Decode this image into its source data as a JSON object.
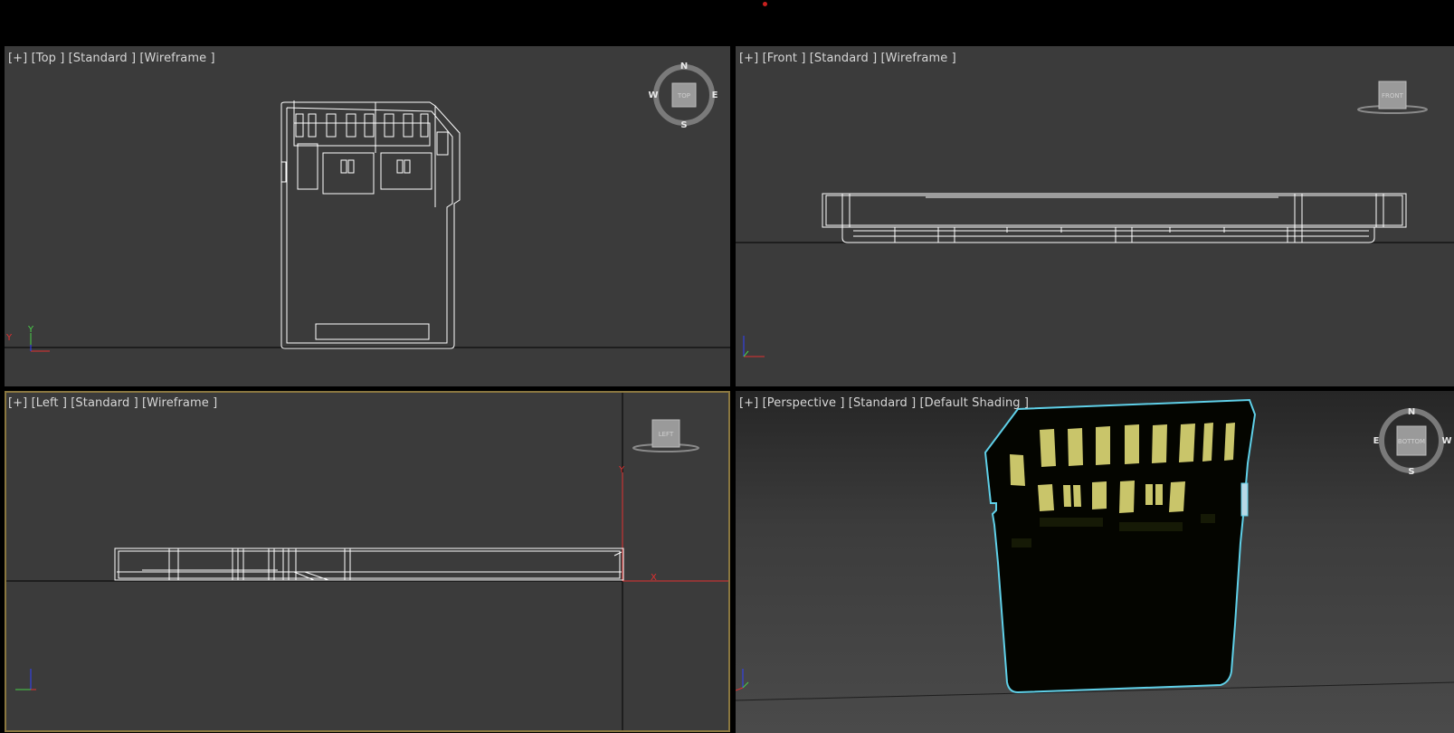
{
  "app": {
    "record_indicator_color": "#c8201e"
  },
  "viewports": {
    "top": {
      "label": "[+] [Top ] [Standard ] [Wireframe ]",
      "viewcube_face": "TOP",
      "compass": {
        "n": "N",
        "s": "S",
        "e": "E",
        "w": "W"
      }
    },
    "front": {
      "label": "[+] [Front ] [Standard ] [Wireframe ]",
      "viewcube_face": "FRONT"
    },
    "left": {
      "label": "[+] [Left ] [Standard ] [Wireframe ]",
      "viewcube_face": "LEFT",
      "axis_labels": {
        "y": "Y",
        "x": "X"
      }
    },
    "perspective": {
      "label": "[+] [Perspective ] [Standard ] [Default Shading ]",
      "viewcube_face": "BOTTOM",
      "compass": {
        "n": "N",
        "s": "S",
        "e": "E",
        "w": "W"
      }
    }
  },
  "colors": {
    "viewport_bg": "#3b3b3b",
    "wire": "#ffffff",
    "selection": "#5fd0e8",
    "contacts": "#c9c56a",
    "active_border": "#8a7740"
  }
}
